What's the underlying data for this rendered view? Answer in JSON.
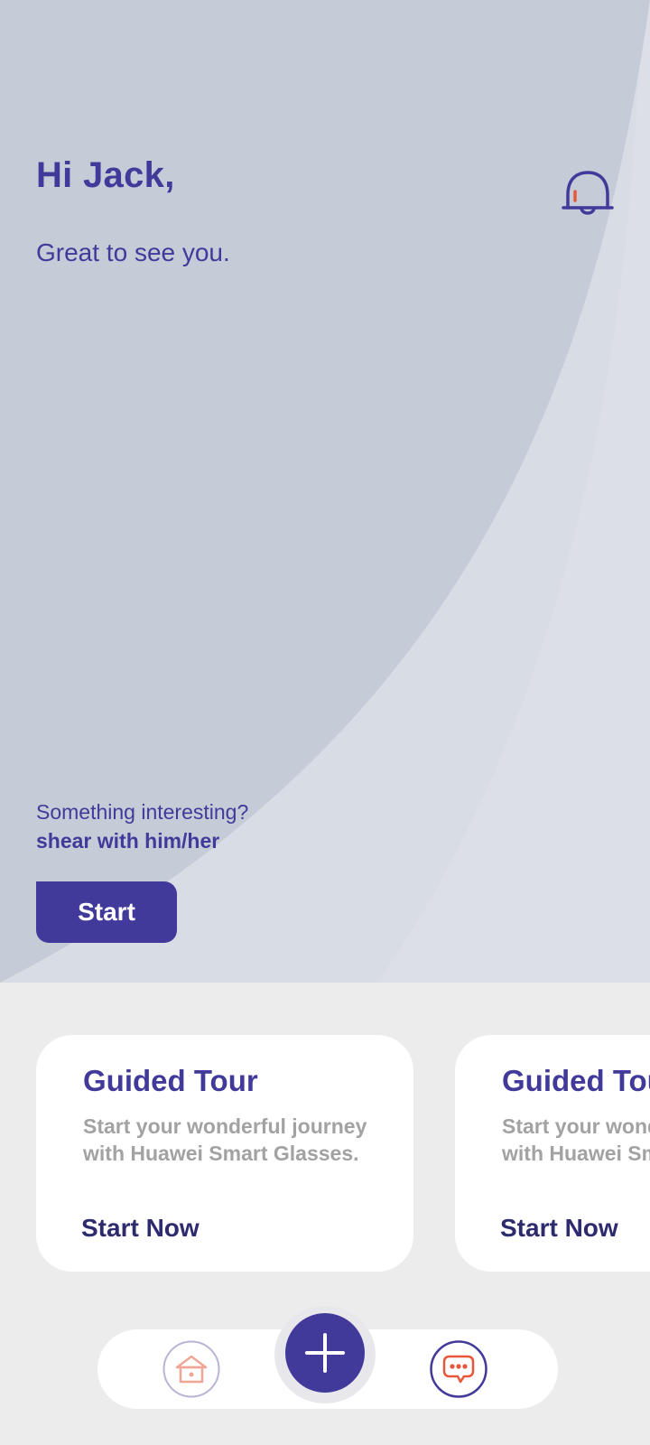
{
  "header": {
    "greeting": "Hi Jack,",
    "subtitle": "Great to see you."
  },
  "share": {
    "prompt": "Something interesting?",
    "prompt_bold": "shear with him/her",
    "start_label": "Start"
  },
  "cards": [
    {
      "title": "Guided Tour",
      "description": "Start your wonderful journey with Huawei Smart Glasses.",
      "link_label": "Start Now"
    },
    {
      "title": "Guided Tour",
      "description": "Start your wonderful journey with Huawei Smart Glasses.",
      "link_label": "Start Now"
    }
  ],
  "nav": {
    "items": [
      "home-icon",
      "add-icon",
      "chat-icon"
    ]
  },
  "colors": {
    "primary": "#423a9a",
    "accent": "#e9573a",
    "hero_light": "#d8dce5",
    "hero_dark": "#c5ccd7",
    "background": "#ececec"
  }
}
